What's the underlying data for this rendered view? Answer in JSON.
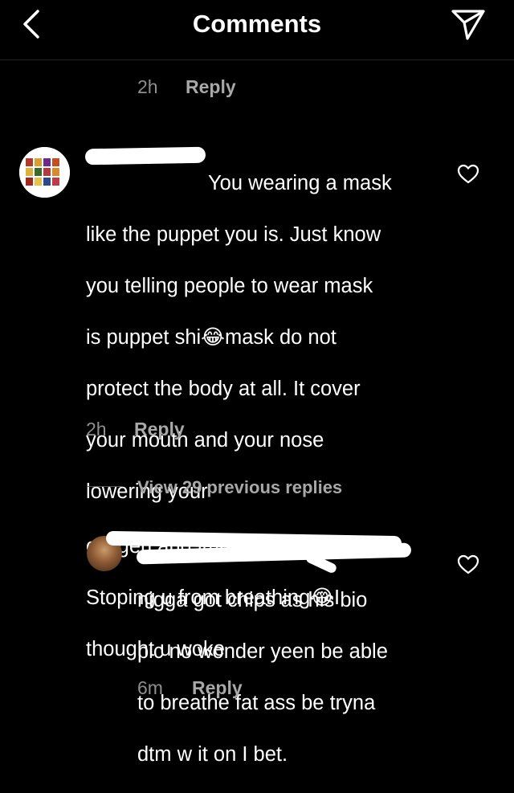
{
  "header": {
    "title": "Comments"
  },
  "previous_comment": {
    "time": "2h",
    "reply_label": "Reply"
  },
  "comment1": {
    "text_lines": [
      "You wearing a mask",
      "like the puppet you is. Just know",
      "you telling people to wear mask",
      "is puppet shi😂mask do not",
      "protect the body at all. It cover",
      "your mouth and your nose",
      "lowering your",
      "oxygen and immune system.",
      "Stoping u from breathing😂I",
      "thought u woke"
    ],
    "time": "2h",
    "reply_label": "Reply"
  },
  "view_replies": {
    "label": "View 29 previous replies"
  },
  "reply1": {
    "text_lines": [
      "nigga got chips as his bio",
      "pic no wonder yeen be able",
      "to breathe fat ass be tryna",
      "dtm w it on I bet."
    ],
    "time": "6m",
    "reply_label": "Reply"
  },
  "icons": {
    "back": "chevron-left-icon",
    "send": "send-icon",
    "like": "heart-icon"
  }
}
